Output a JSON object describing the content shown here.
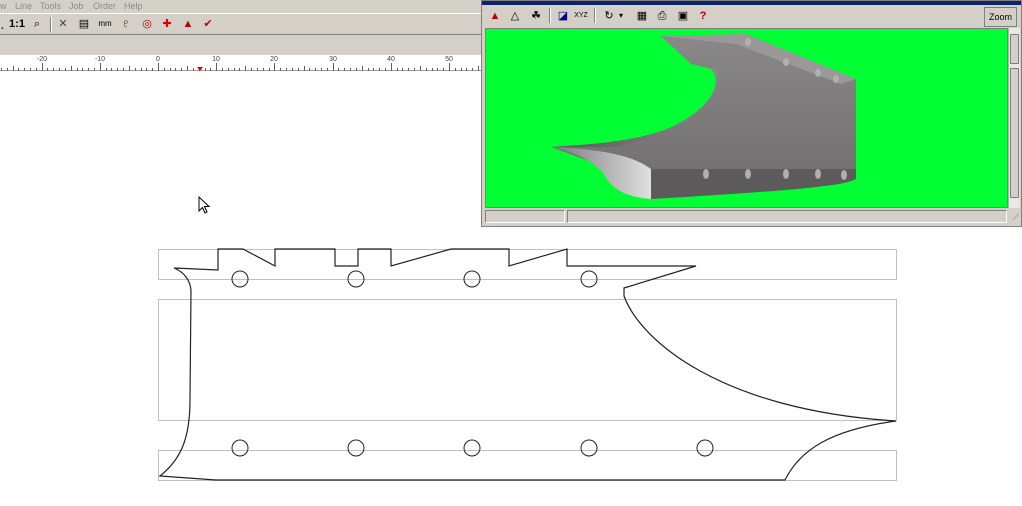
{
  "menu": {
    "items": [
      "w",
      "Line",
      "Tools",
      "Job",
      "Order",
      "Help"
    ]
  },
  "toolbar": {
    "items": [
      {
        "label": "˛",
        "icon": "arrow-icon"
      },
      {
        "label": "1:1",
        "icon": "zoom-1to1-icon"
      },
      {
        "label": "⌕",
        "icon": "zoom-icon"
      },
      {
        "label": "✕",
        "icon": "delete-icon"
      },
      {
        "label": "▤",
        "icon": "properties-icon"
      },
      {
        "label": "mm",
        "icon": "units-mm-icon"
      },
      {
        "label": "♇",
        "icon": "bottle-icon"
      },
      {
        "label": "◎",
        "icon": "circles-icon"
      },
      {
        "label": "✚",
        "icon": "cross-icon"
      },
      {
        "label": "▲",
        "icon": "cone-3d-icon"
      },
      {
        "label": "✔",
        "icon": "check-icon"
      }
    ]
  },
  "ruler": {
    "labels": [
      "-20",
      "-10",
      "0",
      "10",
      "20",
      "30",
      "40",
      "50"
    ]
  },
  "viewer": {
    "toolbar": [
      {
        "label": "▲",
        "icon": "render-icon"
      },
      {
        "label": "△",
        "icon": "wireframe-icon"
      },
      {
        "label": "☘",
        "icon": "shapes-icon"
      },
      {
        "label": "◪",
        "icon": "shading-icon"
      },
      {
        "label": "XYZ",
        "icon": "axes-xyz-icon"
      },
      {
        "label": "↻",
        "icon": "rotate-icon"
      },
      {
        "label": "▾",
        "icon": "dropdown-icon"
      },
      {
        "label": "▦",
        "icon": "palette-icon"
      },
      {
        "label": "⎙",
        "icon": "print-icon"
      },
      {
        "label": "▣",
        "icon": "save-icon"
      },
      {
        "label": "?",
        "icon": "help-icon"
      }
    ],
    "zoom_label": "Zoom",
    "background": "#00ff33"
  }
}
